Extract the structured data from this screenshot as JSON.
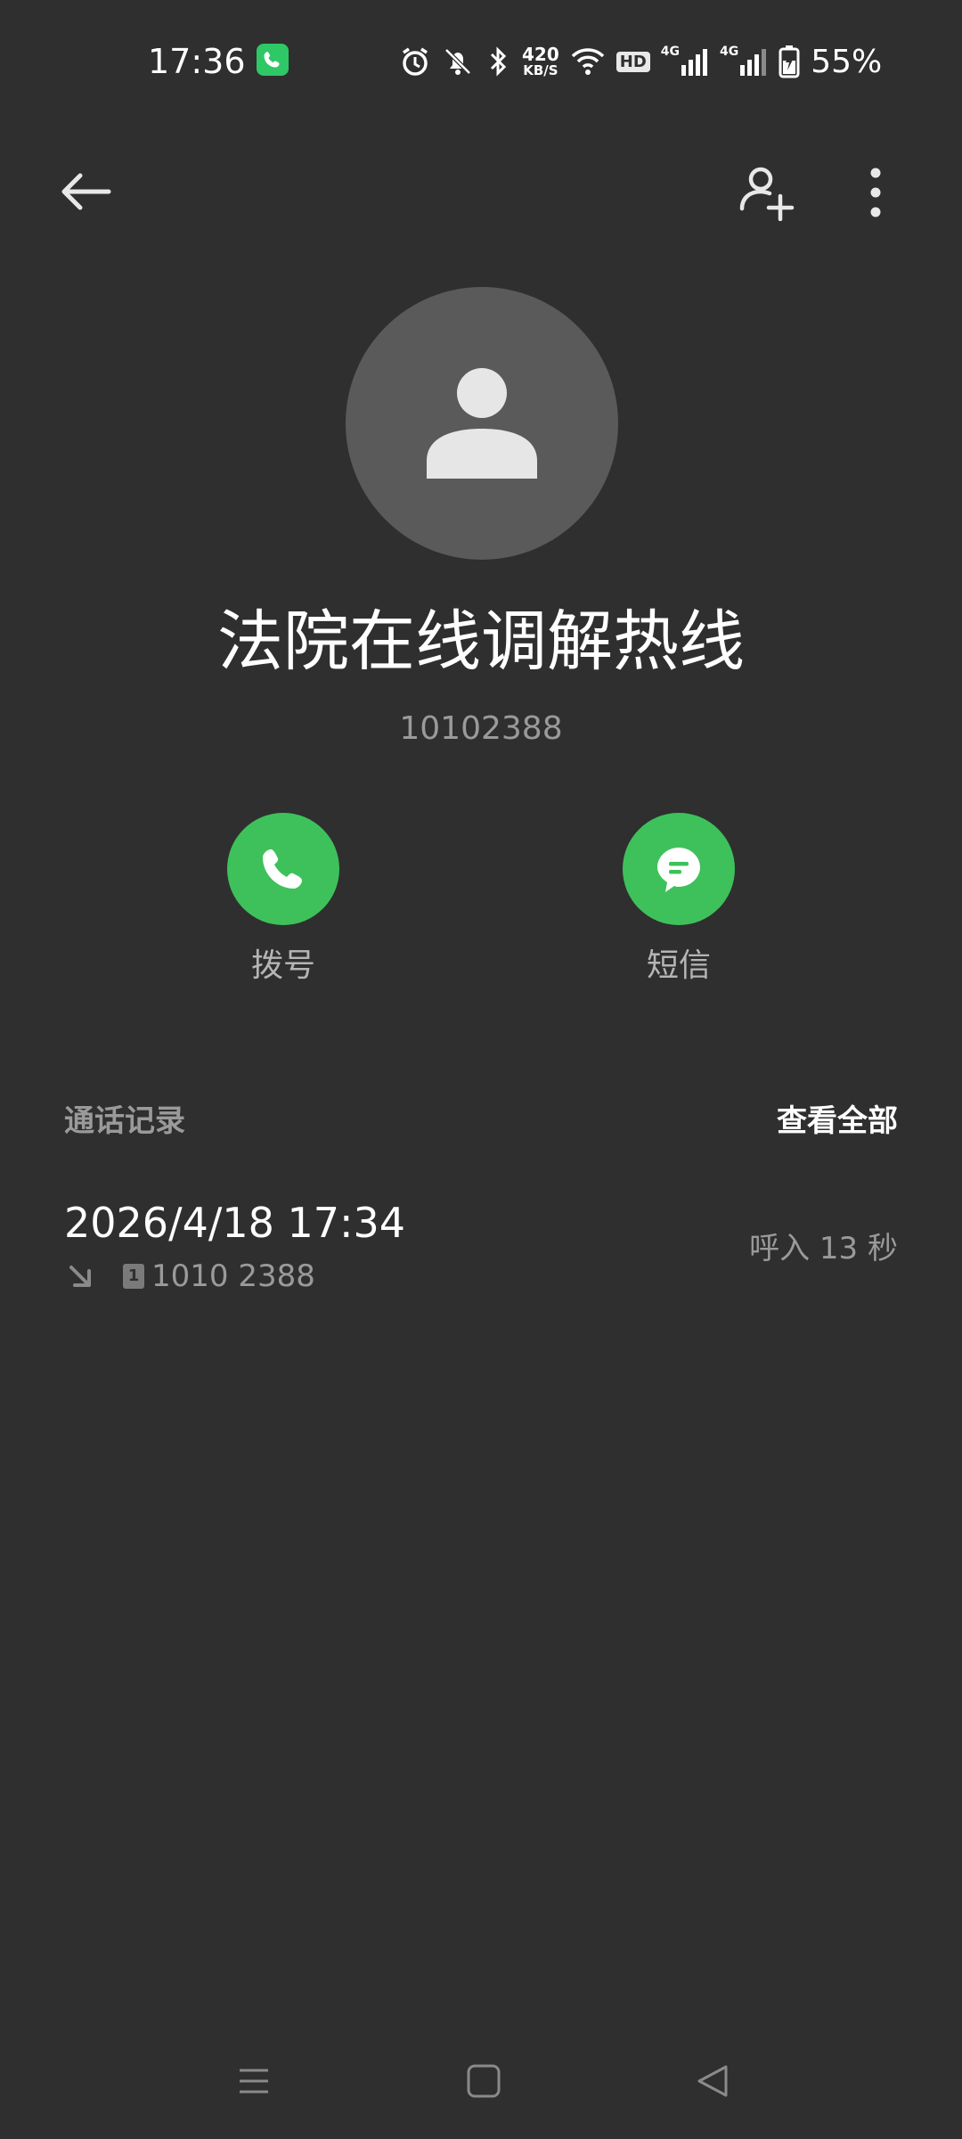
{
  "status_bar": {
    "time": "17:36",
    "net_speed_value": "420",
    "net_speed_unit": "KB/S",
    "hd_label": "HD",
    "signal_1_label": "4G",
    "signal_2_label": "4G",
    "battery": "55%"
  },
  "contact": {
    "name": "法院在线调解热线",
    "number": "10102388"
  },
  "actions": {
    "call_label": "拨号",
    "sms_label": "短信"
  },
  "call_log": {
    "title": "通话记录",
    "view_all": "查看全部",
    "entries": [
      {
        "datetime": "2026/4/18 17:34",
        "sim": "1",
        "number": "1010 2388",
        "type_duration": "呼入  13 秒"
      }
    ]
  },
  "colors": {
    "background": "#2f2f2f",
    "accent_green": "#3ec15b",
    "avatar_bg": "#5a5a5a",
    "secondary_text": "#9a9a9a"
  },
  "icons": {
    "back": "arrow-left-icon",
    "add_contact": "person-add-icon",
    "more": "more-vertical-icon",
    "call": "phone-icon",
    "sms": "message-icon",
    "incoming": "arrow-down-right-icon"
  }
}
